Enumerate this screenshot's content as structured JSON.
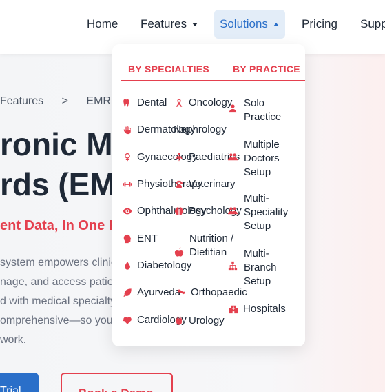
{
  "nav": {
    "home": "Home",
    "features": "Features",
    "solutions": "Solutions",
    "pricing": "Pricing",
    "support": "Supp"
  },
  "hero": {
    "breadcrumb": [
      "Features",
      ">",
      "EMR &"
    ],
    "title_line1": "ronic Medical",
    "title_line2": "rds (EMR)",
    "subtitle": "ent Data, In One Place",
    "body": [
      "system empowers clinics to",
      "nage, and access patient",
      "d with medical specialty",
      "omprehensive—so you can",
      "work."
    ],
    "trial_button": "Trial",
    "demo_button": "Book a Demo"
  },
  "dropdown": {
    "tab_specialties": "BY SPECIALTIES",
    "tab_practice": "BY PRACTICE",
    "specialties_col1": [
      {
        "label": "Dental",
        "icon": "tooth-icon"
      },
      {
        "label": "Dermatology",
        "icon": "hand-icon"
      },
      {
        "label": "Gynaecology",
        "icon": "female-icon"
      },
      {
        "label": "Physiotherapy",
        "icon": "dumbbell-icon"
      },
      {
        "label": "Ophthalmology",
        "icon": "eye-icon"
      },
      {
        "label": "ENT",
        "icon": "head-icon"
      },
      {
        "label": "Diabetology",
        "icon": "drop-icon"
      },
      {
        "label": "Ayurveda",
        "icon": "leaf-icon"
      },
      {
        "label": "Cardiology",
        "icon": "heartbeat-icon"
      }
    ],
    "specialties_col2": [
      {
        "label": "Oncology",
        "icon": "ribbon-icon"
      },
      {
        "label": "Nephrology",
        "icon": "kidney-icon"
      },
      {
        "label": "Paediatrics",
        "icon": "child-icon"
      },
      {
        "label": "Veterinary",
        "icon": "paw-icon"
      },
      {
        "label": "Psychology",
        "icon": "brain-icon"
      },
      {
        "label": "Nutrition / Dietitian",
        "icon": "apple-icon"
      },
      {
        "label": "Orthopaedic",
        "icon": "bone-icon"
      },
      {
        "label": "Urology",
        "icon": "bladder-icon"
      }
    ],
    "practice": [
      {
        "label": "Solo Practice",
        "icon": "user-icon"
      },
      {
        "label": "Multiple Doctors Setup",
        "icon": "users-icon"
      },
      {
        "label": "Multi-Speciality Setup",
        "icon": "users-gear-icon"
      },
      {
        "label": "Multi-Branch Setup",
        "icon": "sitemap-icon"
      },
      {
        "label": "Hospitals",
        "icon": "hospital-icon"
      }
    ]
  },
  "colors": {
    "accent_red": "#e4404e",
    "accent_blue": "#2a6fc9",
    "solutions_bg": "#e3edf8"
  }
}
